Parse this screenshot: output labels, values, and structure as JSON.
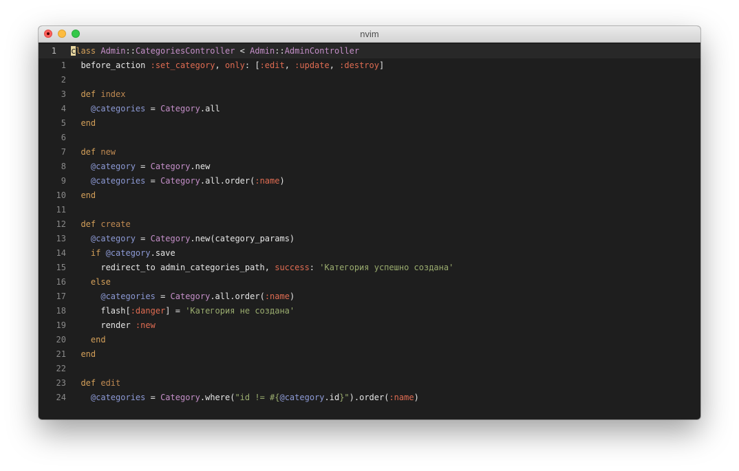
{
  "window": {
    "title": "nvim"
  },
  "colors": {
    "background": "#1e1e1e",
    "keyword": "#d4a05a",
    "function_name": "#c08a52",
    "constant": "#c58fc9",
    "instance_variable": "#8d9ad6",
    "symbol": "#e06c52",
    "string": "#9bad6f",
    "text": "#e6e6e6",
    "cursor": "#e8d7a0"
  },
  "editor": {
    "mode": "relative line numbers",
    "lines": [
      {
        "number": "1",
        "current": true,
        "tokens": [
          {
            "t": "c",
            "k": "cursor"
          },
          {
            "t": "lass ",
            "k": "keyword"
          },
          {
            "t": "Admin",
            "k": "const"
          },
          {
            "t": "::",
            "k": "punct"
          },
          {
            "t": "CategoriesController",
            "k": "const"
          },
          {
            "t": " < ",
            "k": "plain"
          },
          {
            "t": "Admin",
            "k": "const"
          },
          {
            "t": "::",
            "k": "punct"
          },
          {
            "t": "AdminController",
            "k": "const"
          }
        ]
      },
      {
        "number": "1",
        "tokens": [
          {
            "t": "  before_action ",
            "k": "plain"
          },
          {
            "t": ":set_category",
            "k": "sym"
          },
          {
            "t": ", ",
            "k": "plain"
          },
          {
            "t": "only",
            "k": "sym"
          },
          {
            "t": ": [",
            "k": "plain"
          },
          {
            "t": ":edit",
            "k": "sym"
          },
          {
            "t": ", ",
            "k": "plain"
          },
          {
            "t": ":update",
            "k": "sym"
          },
          {
            "t": ", ",
            "k": "plain"
          },
          {
            "t": ":destroy",
            "k": "sym"
          },
          {
            "t": "]",
            "k": "plain"
          }
        ]
      },
      {
        "number": "2",
        "tokens": []
      },
      {
        "number": "3",
        "tokens": [
          {
            "t": "  def ",
            "k": "keyword"
          },
          {
            "t": "index",
            "k": "fn"
          }
        ]
      },
      {
        "number": "4",
        "tokens": [
          {
            "t": "    ",
            "k": "plain"
          },
          {
            "t": "@categories",
            "k": "ivar"
          },
          {
            "t": " = ",
            "k": "plain"
          },
          {
            "t": "Category",
            "k": "const"
          },
          {
            "t": ".all",
            "k": "plain"
          }
        ]
      },
      {
        "number": "5",
        "tokens": [
          {
            "t": "  end",
            "k": "keyword"
          }
        ]
      },
      {
        "number": "6",
        "tokens": []
      },
      {
        "number": "7",
        "tokens": [
          {
            "t": "  def ",
            "k": "keyword"
          },
          {
            "t": "new",
            "k": "fn"
          }
        ]
      },
      {
        "number": "8",
        "tokens": [
          {
            "t": "    ",
            "k": "plain"
          },
          {
            "t": "@category",
            "k": "ivar"
          },
          {
            "t": " = ",
            "k": "plain"
          },
          {
            "t": "Category",
            "k": "const"
          },
          {
            "t": ".new",
            "k": "plain"
          }
        ]
      },
      {
        "number": "9",
        "tokens": [
          {
            "t": "    ",
            "k": "plain"
          },
          {
            "t": "@categories",
            "k": "ivar"
          },
          {
            "t": " = ",
            "k": "plain"
          },
          {
            "t": "Category",
            "k": "const"
          },
          {
            "t": ".all.order(",
            "k": "plain"
          },
          {
            "t": ":name",
            "k": "sym"
          },
          {
            "t": ")",
            "k": "plain"
          }
        ]
      },
      {
        "number": "10",
        "tokens": [
          {
            "t": "  end",
            "k": "keyword"
          }
        ]
      },
      {
        "number": "11",
        "tokens": []
      },
      {
        "number": "12",
        "tokens": [
          {
            "t": "  def ",
            "k": "keyword"
          },
          {
            "t": "create",
            "k": "fn"
          }
        ]
      },
      {
        "number": "13",
        "tokens": [
          {
            "t": "    ",
            "k": "plain"
          },
          {
            "t": "@category",
            "k": "ivar"
          },
          {
            "t": " = ",
            "k": "plain"
          },
          {
            "t": "Category",
            "k": "const"
          },
          {
            "t": ".new(category_params)",
            "k": "plain"
          }
        ]
      },
      {
        "number": "14",
        "tokens": [
          {
            "t": "    if ",
            "k": "keyword"
          },
          {
            "t": "@category",
            "k": "ivar"
          },
          {
            "t": ".save",
            "k": "plain"
          }
        ]
      },
      {
        "number": "15",
        "tokens": [
          {
            "t": "      redirect_to admin_categories_path, ",
            "k": "plain"
          },
          {
            "t": "success",
            "k": "sym"
          },
          {
            "t": ": ",
            "k": "plain"
          },
          {
            "t": "'Категория успешно создана'",
            "k": "str"
          }
        ]
      },
      {
        "number": "16",
        "tokens": [
          {
            "t": "    else",
            "k": "keyword"
          }
        ]
      },
      {
        "number": "17",
        "tokens": [
          {
            "t": "      ",
            "k": "plain"
          },
          {
            "t": "@categories",
            "k": "ivar"
          },
          {
            "t": " = ",
            "k": "plain"
          },
          {
            "t": "Category",
            "k": "const"
          },
          {
            "t": ".all.order(",
            "k": "plain"
          },
          {
            "t": ":name",
            "k": "sym"
          },
          {
            "t": ")",
            "k": "plain"
          }
        ]
      },
      {
        "number": "18",
        "tokens": [
          {
            "t": "      flash[",
            "k": "plain"
          },
          {
            "t": ":danger",
            "k": "sym"
          },
          {
            "t": "] = ",
            "k": "plain"
          },
          {
            "t": "'Категория не создана'",
            "k": "str"
          }
        ]
      },
      {
        "number": "19",
        "tokens": [
          {
            "t": "      render ",
            "k": "plain"
          },
          {
            "t": ":new",
            "k": "sym"
          }
        ]
      },
      {
        "number": "20",
        "tokens": [
          {
            "t": "    end",
            "k": "keyword"
          }
        ]
      },
      {
        "number": "21",
        "tokens": [
          {
            "t": "  end",
            "k": "keyword"
          }
        ]
      },
      {
        "number": "22",
        "tokens": []
      },
      {
        "number": "23",
        "tokens": [
          {
            "t": "  def ",
            "k": "keyword"
          },
          {
            "t": "edit",
            "k": "fn"
          }
        ]
      },
      {
        "number": "24",
        "tokens": [
          {
            "t": "    ",
            "k": "plain"
          },
          {
            "t": "@categories",
            "k": "ivar"
          },
          {
            "t": " = ",
            "k": "plain"
          },
          {
            "t": "Category",
            "k": "const"
          },
          {
            "t": ".where(",
            "k": "plain"
          },
          {
            "t": "\"id != #{",
            "k": "str"
          },
          {
            "t": "@category",
            "k": "ivar"
          },
          {
            "t": ".id",
            "k": "plain"
          },
          {
            "t": "}\"",
            "k": "str"
          },
          {
            "t": ").order(",
            "k": "plain"
          },
          {
            "t": ":name",
            "k": "sym"
          },
          {
            "t": ")",
            "k": "plain"
          }
        ]
      }
    ]
  }
}
